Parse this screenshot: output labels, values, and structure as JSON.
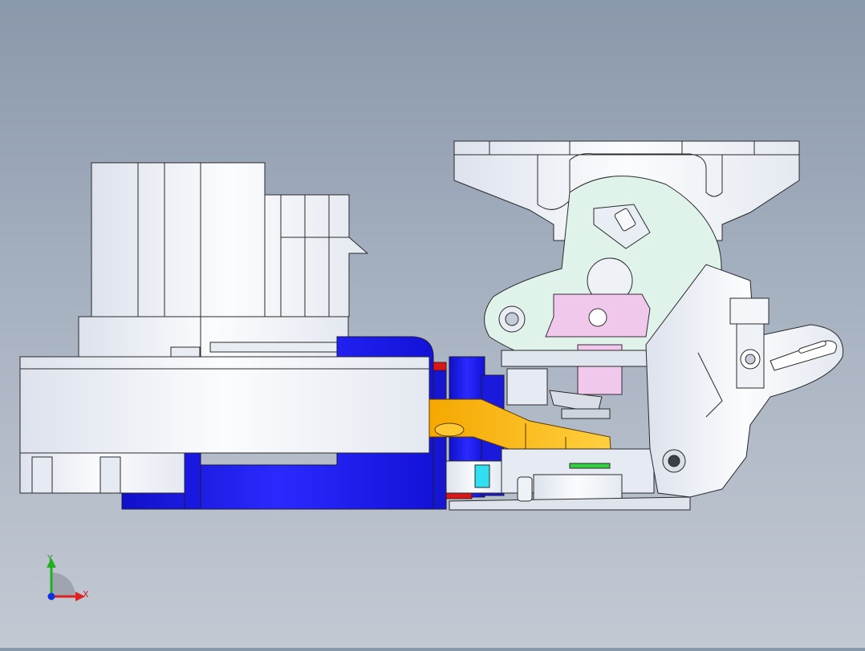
{
  "viewport": {
    "background_top": "#8a98ab",
    "background_bottom": "#c3c9d3"
  },
  "triad": {
    "x_label": "X",
    "y_label": "Y",
    "x_color": "#e02020",
    "y_color": "#20b020",
    "origin_color": "#1030e0"
  },
  "colors": {
    "white_part": "#f2f4f8",
    "blue_part": "#1414e6",
    "yellow_part": "#f5b400",
    "mint_part": "#dff3ea",
    "pink_part": "#f0c8ec",
    "edge": "#2a2a2a"
  }
}
